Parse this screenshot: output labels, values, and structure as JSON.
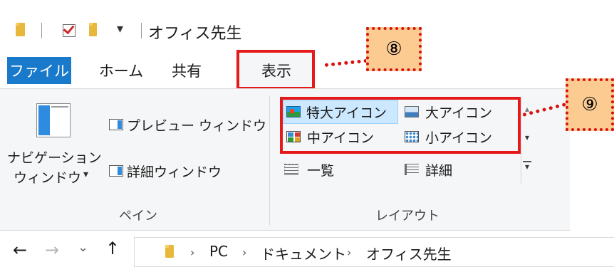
{
  "quick_access": {
    "title": "オフィス先生",
    "dropdown_glyph": "▾"
  },
  "tabs": [
    {
      "label": "ファイル",
      "active_style": "file"
    },
    {
      "label": "ホーム"
    },
    {
      "label": "共有"
    },
    {
      "label": "表示",
      "highlighted": true
    }
  ],
  "callouts": {
    "step8": "⑧",
    "step9": "⑨"
  },
  "ribbon": {
    "pane_group": {
      "nav_pane_label_line1": "ナビゲーション",
      "nav_pane_label_line2": "ウィンドウ",
      "nav_pane_dropdown": "▾",
      "preview_pane": "プレビュー ウィンドウ",
      "details_pane": "詳細ウィンドウ",
      "group_label": "ペイン"
    },
    "layout_group": {
      "extra_large_icons": "特大アイコン",
      "large_icons": "大アイコン",
      "medium_icons": "中アイコン",
      "small_icons": "小アイコン",
      "list": "一覧",
      "details": "詳細",
      "group_label": "レイアウト",
      "selected": "特大アイコン"
    },
    "scroll": {
      "up": "▴",
      "down": "▾",
      "more": "▾"
    }
  },
  "address_bar": {
    "back": "←",
    "forward": "→",
    "recent": "⌄",
    "up": "↑",
    "crumbs": [
      "PC",
      "ドキュメント",
      "オフィス先生"
    ],
    "separator": "›"
  },
  "colors": {
    "file_tab": "#1979ca",
    "highlight_box": "#e51919",
    "callout_fill": "#fbcb92",
    "selected_view": "#cce8ff"
  }
}
